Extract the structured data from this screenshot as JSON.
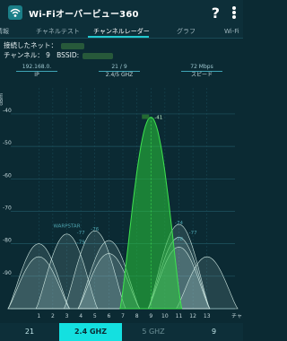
{
  "app": {
    "title": "Wi-Fiオーバービュー360",
    "help": "?"
  },
  "tabs": [
    "情報",
    "チャネルテスト",
    "チャンネルレーダー",
    "グラフ",
    "Wi-Fi"
  ],
  "info": {
    "connected_label": "接続したネット：",
    "channel_label": "チャンネル：",
    "channel_value": "9",
    "bssid_label": "BSSID:"
  },
  "stats": {
    "ip_value": "192.168.0.",
    "ip_label": "IP",
    "band_value": "21 / 9",
    "band_label": "2.4/5 GHZ",
    "speed_value": "72 Mbps",
    "speed_label": "スピード"
  },
  "chart_data": {
    "type": "area",
    "ylabel": "dBm",
    "y_ticks": [
      -40,
      -50,
      -60,
      -70,
      -80,
      -90
    ],
    "ylim": [
      -100,
      -32
    ],
    "x_ticks": [
      1,
      2,
      3,
      4,
      5,
      6,
      7,
      8,
      9,
      10,
      11,
      12,
      13
    ],
    "x_label": "チャン",
    "connected_channel": 9,
    "connected_peak_label": "-41",
    "series": [
      {
        "channel": 9,
        "peak": -41,
        "highlight": true
      },
      {
        "channel": 1,
        "peak": -80
      },
      {
        "channel": 1,
        "peak": -84
      },
      {
        "channel": 3,
        "peak": -77
      },
      {
        "channel": 5,
        "peak": -76
      },
      {
        "channel": 6,
        "peak": -79
      },
      {
        "channel": 6,
        "peak": -83
      },
      {
        "channel": 11,
        "peak": -74
      },
      {
        "channel": 11,
        "peak": -78
      },
      {
        "channel": 11,
        "peak": -81
      },
      {
        "channel": 13,
        "peak": -84
      }
    ],
    "ap_labels": [
      {
        "text": "WARPSTAR",
        "channel": 3,
        "dbm": -75
      },
      {
        "text": "-77",
        "channel": 4,
        "dbm": -77
      },
      {
        "text": "-76",
        "channel": 5,
        "dbm": -76
      },
      {
        "text": "-79",
        "channel": 4,
        "dbm": -80
      },
      {
        "text": "-74",
        "channel": 11,
        "dbm": -74
      },
      {
        "text": "-77",
        "channel": 12,
        "dbm": -77
      },
      {
        "text": "-78",
        "channel": 11,
        "dbm": -79
      }
    ]
  },
  "bottom": {
    "count": "21",
    "band24": "2.4 GHZ",
    "band5": "5 GHZ",
    "count5": "9"
  },
  "colors": {
    "background": "#0b2a33",
    "accent": "#14e0e0",
    "highlight_curve": "#29c83a"
  }
}
